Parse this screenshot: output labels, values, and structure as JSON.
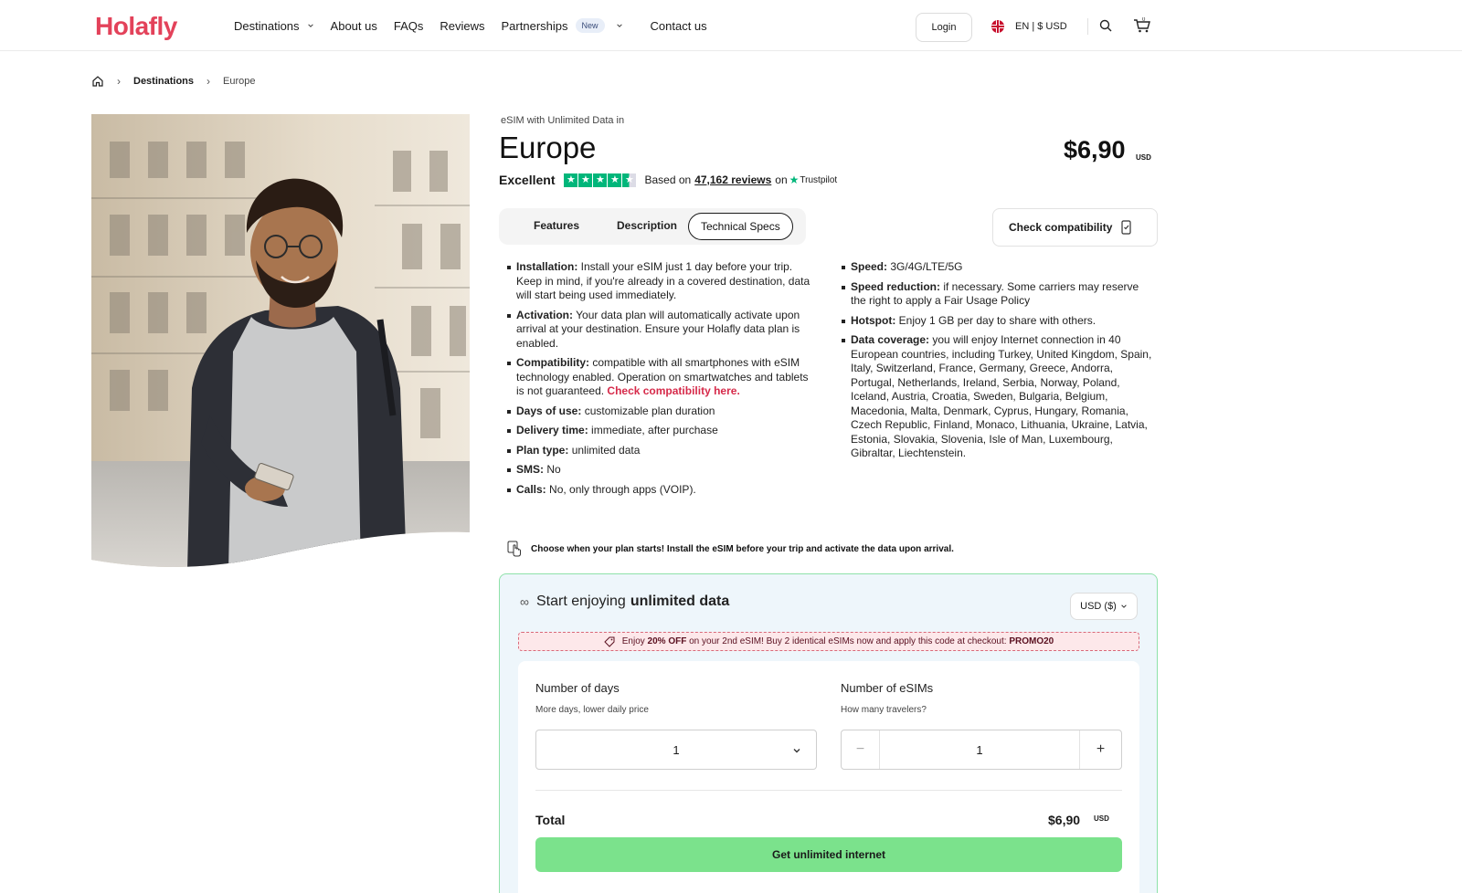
{
  "header": {
    "logo": "Holafly",
    "nav": [
      {
        "label": "Destinations",
        "has_dropdown": true
      },
      {
        "label": "About us"
      },
      {
        "label": "FAQs"
      },
      {
        "label": "Reviews"
      },
      {
        "label": "Partnerships",
        "badge": "New",
        "has_dropdown": true
      },
      {
        "label": "Contact us"
      }
    ],
    "login": "Login",
    "language": "EN | $ USD",
    "cart_count": "0"
  },
  "breadcrumb": {
    "items": [
      "Destinations",
      "Europe"
    ]
  },
  "product": {
    "pre_title": "eSIM with Unlimited Data in",
    "title": "Europe",
    "price": "$6,90",
    "price_currency": "USD",
    "rating_label": "Excellent",
    "rating_stars": 4.5,
    "reviews_prefix": "Based on",
    "reviews_link": "47,162 reviews",
    "reviews_suffix": "on",
    "trustpilot": "Trustpilot"
  },
  "tabs": [
    "Features",
    "Description",
    "Technical Specs"
  ],
  "active_tab": "Technical Specs",
  "check_compat_button": "Check compatibility",
  "specs_left": [
    {
      "key": "Installation:",
      "text": " Install your eSIM just 1 day before your trip. Keep in mind, if you're already in a covered destination, data will start being used immediately."
    },
    {
      "key": "Activation:",
      "text": " Your data plan will automatically activate upon arrival at your destination. Ensure your Holafly data plan is enabled."
    },
    {
      "key": "Compatibility:",
      "text": " compatible with all smartphones with eSIM technology enabled. Operation on smartwatches and tablets is not guaranteed. ",
      "link": "Check compatibility here."
    },
    {
      "key": "Days of use:",
      "text": " customizable plan duration"
    },
    {
      "key": "Delivery time:",
      "text": " immediate, after purchase"
    },
    {
      "key": "Plan type:",
      "text": " unlimited data"
    },
    {
      "key": "SMS:",
      "text": " No"
    },
    {
      "key": "Calls:",
      "text": " No, only through apps (VOIP)."
    }
  ],
  "specs_right": [
    {
      "key": "Speed:",
      "text": " 3G/4G/LTE/5G"
    },
    {
      "key": "Speed reduction:",
      "text": " if necessary. Some carriers may reserve the right to apply a Fair Usage Policy"
    },
    {
      "key": "Hotspot:",
      "text": " Enjoy 1 GB per day to share with others."
    },
    {
      "key": "Data coverage:",
      "text": " you will enjoy Internet connection in 40 European countries, including Turkey, United Kingdom, Spain, Italy, Switzerland, France, Germany, Greece, Andorra, Portugal, Netherlands, Ireland, Serbia, Norway, Poland, Iceland, Austria, Croatia, Sweden, Bulgaria, Belgium, Macedonia, Malta, Denmark, Cyprus, Hungary, Romania, Czech Republic, Finland, Monaco, Lithuania, Ukraine, Latvia, Estonia, Slovakia, Slovenia, Isle of Man, Luxembourg, Gibraltar, Liechtenstein."
    }
  ],
  "plan_note": "Choose when your plan starts! Install the eSIM before your trip and activate the data upon arrival.",
  "purchase": {
    "title_prefix": "Start enjoying",
    "title_bold": "unlimited data",
    "currency_select": "USD ($)",
    "promo_prefix": "Enjoy",
    "promo_bold": "20% OFF",
    "promo_middle": "on your 2nd eSIM! Buy 2 identical eSIMs now and apply this code at checkout:",
    "promo_code": "PROMO20",
    "days_label": "Number of days",
    "days_sub": "More days, lower daily price",
    "days_value": "1",
    "esims_label": "Number of eSIMs",
    "esims_sub": "How many travelers?",
    "esims_value": "1",
    "minus": "−",
    "plus": "+",
    "total_label": "Total",
    "total_value": "$6,90",
    "total_currency": "USD",
    "cta": "Get unlimited internet"
  },
  "colors": {
    "brand": "#e3425a",
    "cta": "#7be28c",
    "trustpilot": "#00b67a",
    "card_bg": "#eef6fb",
    "card_border": "#8ee2a9"
  }
}
